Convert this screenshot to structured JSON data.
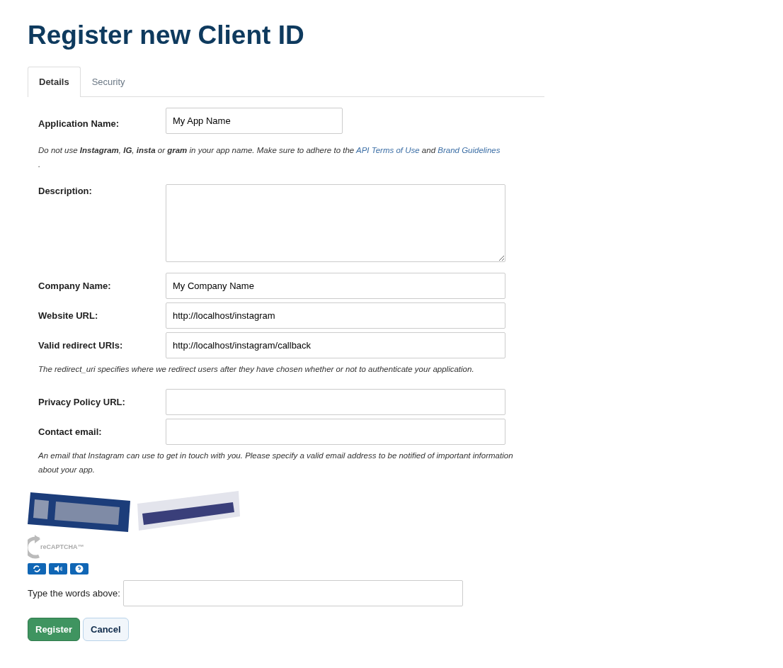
{
  "title": "Register new Client ID",
  "tabs": [
    {
      "label": "Details",
      "selected": true
    },
    {
      "label": "Security",
      "selected": false
    }
  ],
  "fields": [
    {
      "kind": "input",
      "label": "Application Name:",
      "value": "My App Name",
      "short": true
    },
    {
      "kind": "hint",
      "text": "Do not use **Instagram**, **IG**, **insta** or **gram** in your app name. Make sure to adhere to the ",
      "links": [
        "API Terms of Use",
        "Brand Guidelines"
      ],
      "joiner": " and ",
      "end": "."
    },
    {
      "kind": "textarea",
      "label": "Description:"
    },
    {
      "kind": "input",
      "label": "Company Name:",
      "value": "My Company Name"
    },
    {
      "kind": "input",
      "label": "Website URL:",
      "value": "http://localhost/instagram"
    },
    {
      "kind": "input",
      "label": "Valid redirect URIs:",
      "value": "http://localhost/instagram/callback"
    },
    {
      "kind": "note",
      "text": "The redirect_uri specifies where we redirect users after they have chosen whether or not to authenticate your application."
    },
    {
      "kind": "input",
      "label": "Privacy Policy URL:"
    },
    {
      "kind": "input",
      "label": "Contact email:"
    },
    {
      "kind": "note",
      "text": "An email that Instagram can use to get in touch with you. Please specify a valid email address to be notified of important information about your app."
    }
  ],
  "captcha": {
    "logo": "reCAPTCHA™",
    "answer_label": "Type the words above:"
  },
  "buttons": [
    {
      "label": "Register",
      "kind": "primary"
    },
    {
      "label": "Cancel",
      "kind": "secondary"
    }
  ]
}
